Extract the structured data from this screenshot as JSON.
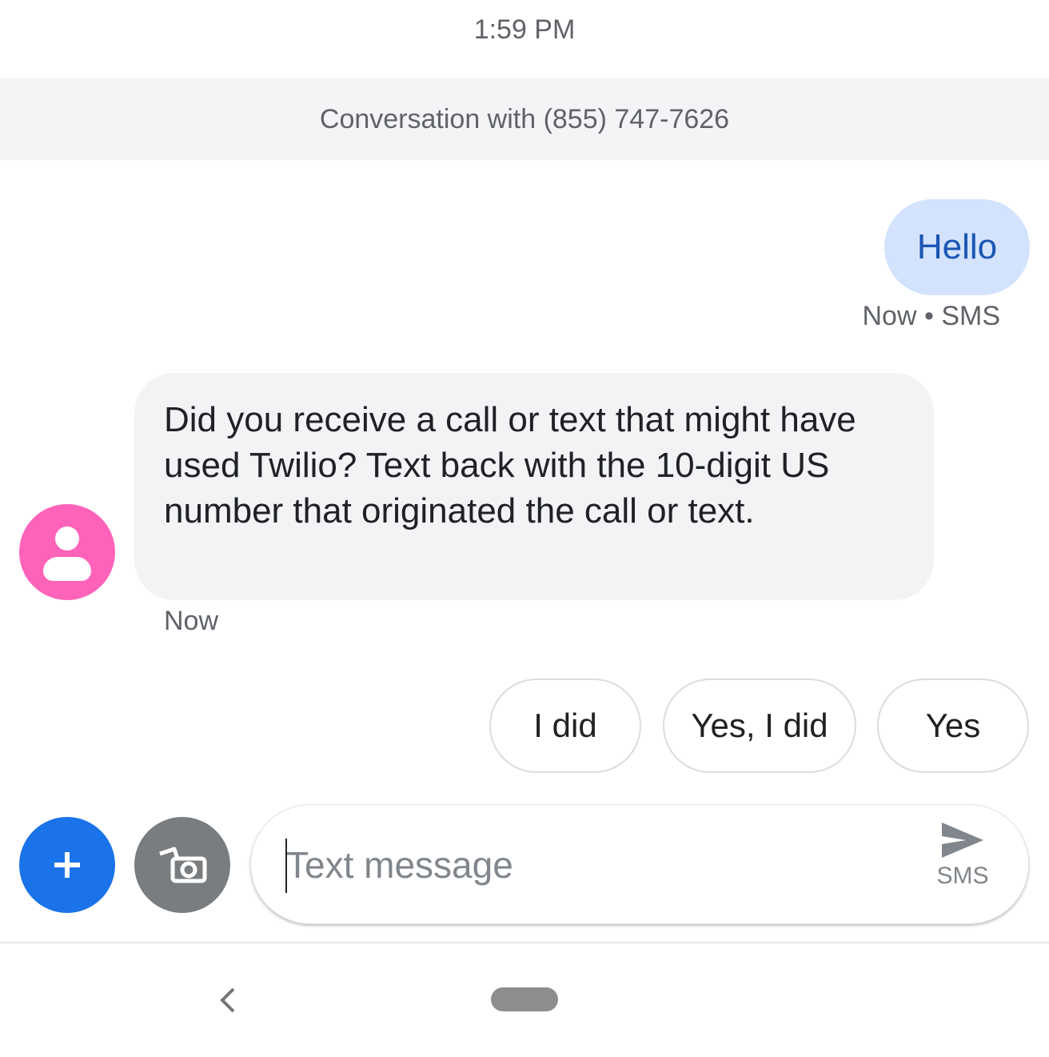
{
  "status_bar": {
    "time": "1:59 PM"
  },
  "conversation": {
    "banner": "Conversation with (855) 747-7626"
  },
  "messages": [
    {
      "direction": "sent",
      "text": "Hello",
      "meta": "Now • SMS"
    },
    {
      "direction": "received",
      "text": "Did you receive a call or text that might have used Twilio? Text back with the 10-digit US number that originated the call or text.",
      "meta": "Now"
    }
  ],
  "smart_replies": [
    "I did",
    "Yes, I did",
    "Yes"
  ],
  "compose": {
    "placeholder": "Text message",
    "value": "",
    "send_label": "SMS"
  },
  "icons": {
    "plus": "plus-icon",
    "camera": "camera-gallery-icon",
    "send": "send-icon",
    "avatar": "person-icon",
    "back": "back-chevron-icon"
  },
  "colors": {
    "accent": "#1a73e8",
    "sent_bubble": "#d3e3fd",
    "received_bubble": "#f1f3f4",
    "avatar": "#ff63b9"
  }
}
